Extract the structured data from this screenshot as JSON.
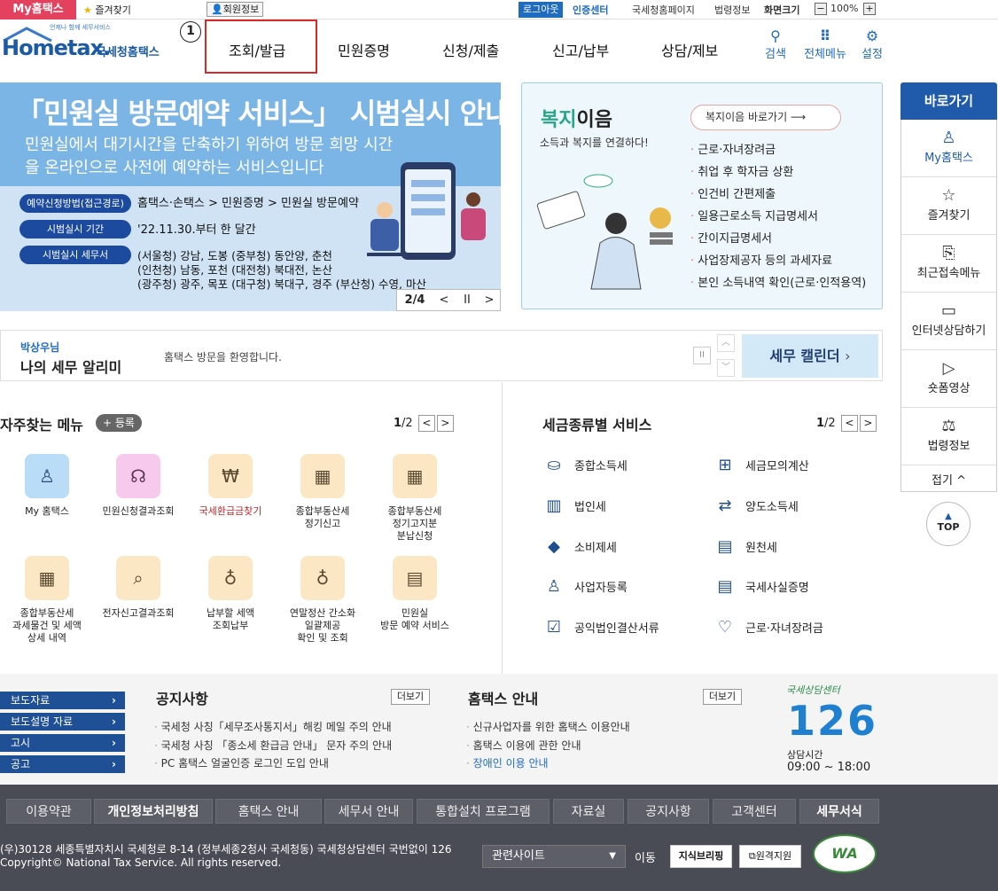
{
  "topbar": {
    "my_hometax": "My홈택스",
    "favorites": "즐겨찾기",
    "member_info": "회원정보",
    "logout": "로그아웃",
    "cert_center": "인증센터",
    "nts_homepage": "국세청홈페이지",
    "law_info": "법령정보",
    "screen_size": "화면크기",
    "zoom_minus": "−",
    "zoom_level": "100%",
    "zoom_plus": "+"
  },
  "header": {
    "logo_small": "언제나 함께 세무서비스",
    "logo_main": "Hometax.",
    "logo_sub": "국세청홈택스",
    "callout_number": "1",
    "nav": [
      "조회/발급",
      "민원증명",
      "신청/제출",
      "신고/납부",
      "상담/제보"
    ],
    "tools": [
      "검색",
      "전체메뉴",
      "설정"
    ]
  },
  "banner": {
    "title": "「민원실 방문예약 서비스」 시범실시 안내",
    "subtitle": "민원실에서 대기시간을 단축하기 위하여 방문 희망 시간을 온라인으로 사전에 예약하는 서비스입니다",
    "rows": [
      {
        "pill": "예약신청방법(접근경로)",
        "text": "홈택스·손택스 > 민원증명 > 민원실 방문예약"
      },
      {
        "pill": "시범실시 기간",
        "text": "'22.11.30.부터 한 달간"
      },
      {
        "pill": "시범실시 세무서",
        "text": "(서울청) 강남, 도봉 (중부청) 동안양, 춘천\n(인천청) 남동, 포천 (대전청) 북대전, 논산\n(광주청) 광주, 목포 (대구청) 북대구, 경주 (부산청) 수영, 마산"
      }
    ],
    "page_current": "2",
    "page_total": "/4",
    "prev": "<",
    "pause": "II",
    "next": ">"
  },
  "welfare": {
    "title_a": "복지",
    "title_b": "이음",
    "subtitle": "소득과 복지를 연결하다!",
    "button": "복지이음 바로가기",
    "items": [
      "근로·자녀장려금",
      "취업 후 학자금 상환",
      "인건비 간편제출",
      "일용근로소득 지급명세서",
      "간이지급명세서",
      "사업장제공자 등의 과세자료",
      "본인 소득내역 확인(근로·인적용역)"
    ]
  },
  "sidebar": {
    "title": "바로가기",
    "items": [
      "My홈택스",
      "즐겨찾기",
      "최근접속메뉴",
      "인터넷상담하기",
      "숏폼영상",
      "법령정보"
    ],
    "collapse": "접기 ^",
    "top": "TOP"
  },
  "alert": {
    "user": "박상우님",
    "title": "나의 세무 알리미",
    "message": "홈택스 방문을 환영합니다.",
    "pause": "II",
    "calendar": "세무 캘린더",
    "calendar_arrow": "›"
  },
  "favorites_menu": {
    "title": "자주찾는 메뉴",
    "register": "+ 등록",
    "page_current": "1",
    "page_total": "/2",
    "prev": "<",
    "next": ">",
    "items": [
      "My 홈택스",
      "민원신청결과조회",
      "국세환급금찾기",
      "종합부동산세\n정기신고",
      "종합부동산세\n정기고지분\n분납신청",
      "종합부동산세\n과세물건 및 세액\n상세 내역",
      "전자신고결과조회",
      "납부할 세액\n조회납부",
      "연말정산 간소화\n일괄제공\n확인 및 조회",
      "민원실\n방문 예약 서비스"
    ]
  },
  "tax_services": {
    "title": "세금종류별 서비스",
    "page_current": "1",
    "page_total": "/2",
    "prev": "<",
    "next": ">",
    "items": [
      "종합소득세",
      "세금모의계산",
      "법인세",
      "양도소득세",
      "소비제세",
      "원천세",
      "사업자등록",
      "국세사실증명",
      "공익법인결산서류",
      "근로·자녀장려금"
    ]
  },
  "notice": {
    "tabs": [
      "보도자료",
      "보도설명 자료",
      "고시",
      "공고"
    ],
    "notice_title": "공지사항",
    "more": "더보기",
    "notice_items": [
      "국세청 사칭「세무조사통지서」해킹 메일 주의 안내",
      "국세청 사칭 「종소세 환급금 안내」 문자 주의 안내",
      "PC 홈택스 얼굴인증 로그인 도입 안내"
    ],
    "guide_title": "홈택스 안내",
    "guide_items": [
      "신규사업자를 위한 홈택스 이용안내",
      "홈택스 이용에 관한 안내",
      "장애인 이용 안내"
    ],
    "center_label": "국세상담센터",
    "center_number": "126",
    "center_hours_label": "상담시간",
    "center_hours": "09:00 ~ 18:00"
  },
  "footer": {
    "links": [
      "이용약관",
      "개인정보처리방침",
      "홈택스 안내",
      "세무서 안내",
      "통합설치 프로그램",
      "자료실",
      "공지사항",
      "고객센터",
      "세무서식"
    ],
    "address": "(우)30128 세종특별자치시 국세청로 8-14 (정부세종2청사 국세청동) 국세청상담센터 국번없이 126",
    "copyright": "Copyright© National Tax Service. All rights reserved.",
    "related_site": "관련사이트",
    "go": "이동",
    "btn_policy": "지식브리핑",
    "btn_remote": "원격지원",
    "wa_mark": "WA"
  }
}
